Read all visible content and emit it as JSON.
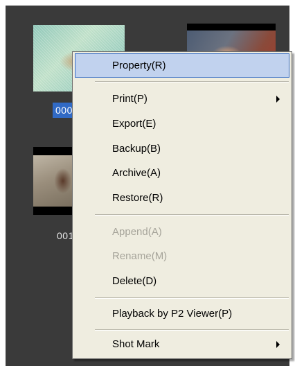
{
  "thumbnails": [
    {
      "label": "000",
      "selected": true
    },
    {
      "label": "",
      "selected": false
    },
    {
      "label": "001",
      "selected": false
    }
  ],
  "context_menu": {
    "items": [
      {
        "label": "Property(R)",
        "state": "highlighted"
      },
      {
        "label": "Print(P)",
        "submenu": true,
        "icon": "chevron-right-icon"
      },
      {
        "label": "Export(E)"
      },
      {
        "label": "Backup(B)"
      },
      {
        "label": "Archive(A)"
      },
      {
        "label": "Restore(R)"
      },
      {
        "label": "Append(A)",
        "state": "disabled"
      },
      {
        "label": "Rename(M)",
        "state": "disabled"
      },
      {
        "label": "Delete(D)"
      },
      {
        "label": "Playback by P2 Viewer(P)"
      },
      {
        "label": "Shot Mark",
        "submenu": true,
        "icon": "chevron-right-icon"
      }
    ]
  },
  "colors": {
    "panel_bg": "#3a3a3a",
    "menu_bg": "#efede0",
    "highlight_bg": "#c1d2ee",
    "highlight_border": "#316ac5",
    "selection": "#316ac5",
    "disabled_text": "#a6a49a"
  }
}
